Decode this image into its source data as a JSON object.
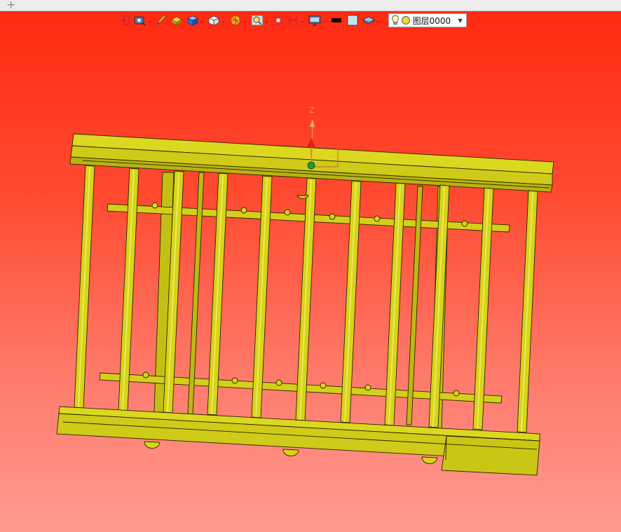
{
  "tabbar": {
    "add_label": "+"
  },
  "toolbar": {
    "items": [
      {
        "icon": "exit-sketch-icon"
      },
      {
        "icon": "view-orient-icon",
        "dropdown": true
      },
      {
        "icon": "pen-icon"
      },
      {
        "icon": "box-solid-icon"
      },
      {
        "icon": "cube-display-icon",
        "dropdown": true
      },
      {
        "icon": "white-cube-icon",
        "dropdown": true
      },
      {
        "icon": "section-view-icon",
        "dropdown": true
      },
      {
        "icon": "zoom-window-icon",
        "dropdown": true
      },
      {
        "icon": "zoom-fit-icon"
      },
      {
        "icon": "dimension-icon",
        "dropdown": true
      },
      {
        "icon": "monitor-display-icon",
        "dropdown": true
      },
      {
        "icon": "line-color-icon"
      },
      {
        "icon": "fill-color-icon"
      },
      {
        "icon": "layer-stack-icon",
        "dropdown": true
      }
    ],
    "layer_select": {
      "value": "图层0000",
      "bulb_icon": "lightbulb-icon",
      "color_icon": "layer-color-icon"
    }
  },
  "viewport": {
    "background_top": "#ff2a12",
    "background_bottom": "#ff9a92",
    "model_color": "#d8d41a",
    "triad_label": "Z"
  }
}
